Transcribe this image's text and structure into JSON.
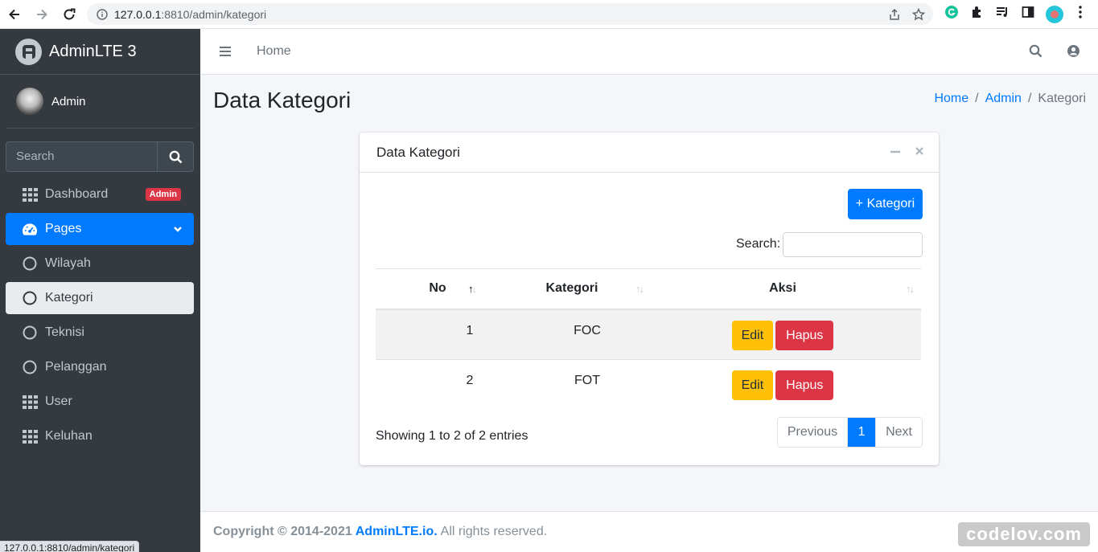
{
  "browser": {
    "url_host": "127.0.0.1",
    "url_path": ":8810/admin/kategori",
    "status_url": "127.0.0.1:8810/admin/kategori"
  },
  "brand": {
    "name": "AdminLTE 3"
  },
  "user": {
    "name": "Admin"
  },
  "sidebar": {
    "search_placeholder": "Search",
    "items": [
      {
        "label": "Dashboard",
        "icon": "grid-icon",
        "badge": "Admin"
      },
      {
        "label": "Pages",
        "icon": "tachometer-icon",
        "active": true
      },
      {
        "label": "Wilayah",
        "icon": "circle-icon"
      },
      {
        "label": "Kategori",
        "icon": "circle-icon",
        "selected": true
      },
      {
        "label": "Teknisi",
        "icon": "circle-icon"
      },
      {
        "label": "Pelanggan",
        "icon": "circle-icon"
      },
      {
        "label": "User",
        "icon": "grid-icon"
      },
      {
        "label": "Keluhan",
        "icon": "grid-icon"
      }
    ]
  },
  "navbar": {
    "home": "Home"
  },
  "page": {
    "title": "Data Kategori",
    "breadcrumb": [
      "Home",
      "Admin",
      "Kategori"
    ]
  },
  "card": {
    "title": "Data Kategori",
    "add_button": "+ Kategori",
    "search_label": "Search:",
    "columns": [
      "No",
      "Kategori",
      "Aksi"
    ],
    "rows": [
      {
        "no": "1",
        "kategori": "FOC"
      },
      {
        "no": "2",
        "kategori": "FOT"
      }
    ],
    "edit_label": "Edit",
    "delete_label": "Hapus",
    "info": "Showing 1 to 2 of 2 entries",
    "pager": {
      "prev": "Previous",
      "page": "1",
      "next": "Next"
    }
  },
  "footer": {
    "copyright": "Copyright © 2014-2021",
    "link": "AdminLTE.io.",
    "rights": "All rights reserved."
  },
  "watermark": "codelov.com",
  "colors": {
    "primary": "#007bff",
    "danger": "#dc3545",
    "warning": "#ffc107",
    "sidebar": "#343a40"
  }
}
